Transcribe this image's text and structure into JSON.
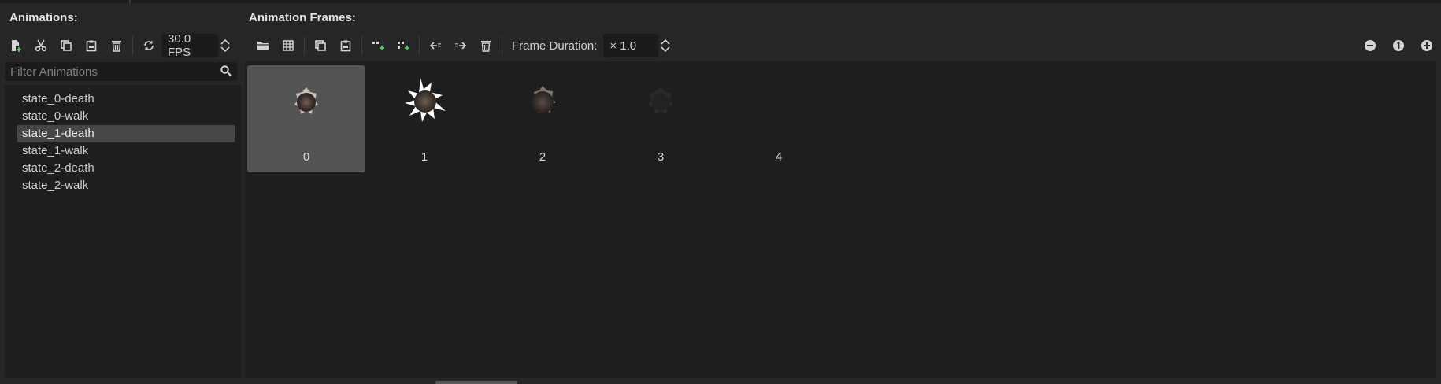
{
  "left_panel": {
    "title": "Animations:",
    "fps_value": "30.0 FPS",
    "filter_placeholder": "Filter Animations",
    "animations": [
      "state_0-death",
      "state_0-walk",
      "state_1-death",
      "state_1-walk",
      "state_2-death",
      "state_2-walk"
    ],
    "selected_animation": "state_1-death"
  },
  "right_panel": {
    "title": "Animation Frames:",
    "frame_duration_label": "Frame Duration:",
    "frame_duration_value": "× 1.0",
    "frames": [
      {
        "label": "0",
        "selected": true
      },
      {
        "label": "1",
        "selected": false
      },
      {
        "label": "2",
        "selected": false
      },
      {
        "label": "3",
        "selected": false
      },
      {
        "label": "4",
        "selected": false
      }
    ]
  },
  "colors": {
    "background": "#262626",
    "panel": "#1e1e1e",
    "selection": "#464646",
    "frame_selection": "#545454",
    "accent_green": "#4fc35a"
  },
  "icons": {
    "left_toolbar": [
      "new-animation-icon",
      "cut-icon",
      "copy-icon",
      "paste-icon",
      "delete-icon",
      "loop-icon"
    ],
    "right_toolbar": [
      "load-frames-icon",
      "load-spritesheet-icon",
      "copy-frame-icon",
      "paste-frame-icon",
      "insert-before-icon",
      "insert-after-icon",
      "move-left-icon",
      "move-right-icon",
      "delete-frame-icon"
    ],
    "zoom": [
      "zoom-out-icon",
      "zoom-reset-icon",
      "zoom-in-icon"
    ]
  }
}
